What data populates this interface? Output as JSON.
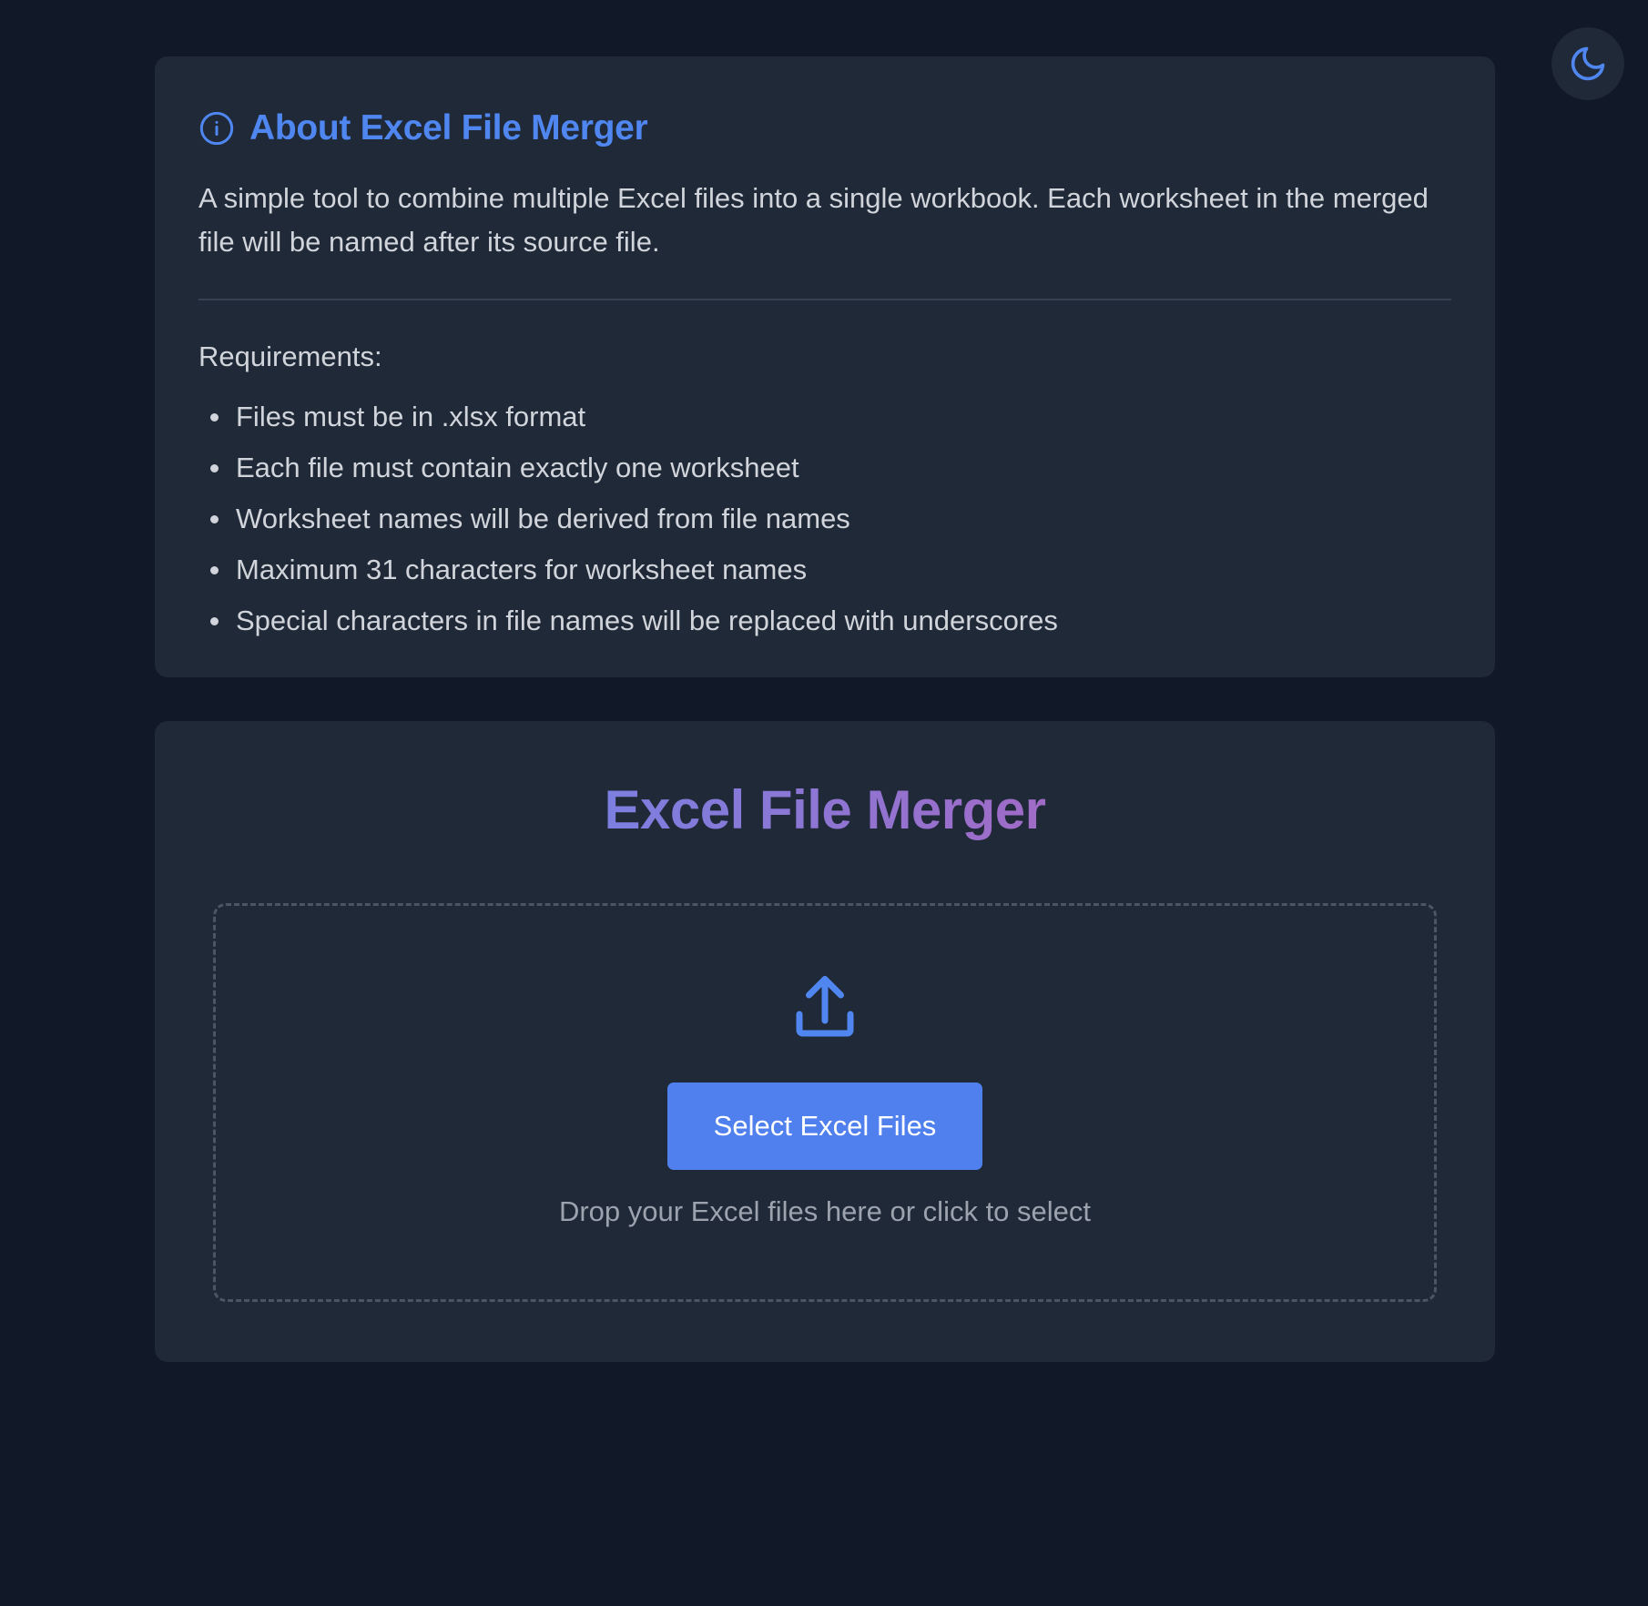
{
  "theme_toggle": {
    "icon": "moon-icon",
    "label": "Toggle dark mode"
  },
  "about": {
    "icon": "info-icon",
    "title": "About Excel File Merger",
    "description": "A simple tool to combine multiple Excel files into a single workbook. Each worksheet in the merged file will be named after its source file.",
    "requirements_title": "Requirements:",
    "requirements": [
      "Files must be in .xlsx format",
      "Each file must contain exactly one worksheet",
      "Worksheet names will be derived from file names",
      "Maximum 31 characters for worksheet names",
      "Special characters in file names will be replaced with underscores"
    ]
  },
  "merger": {
    "title": "Excel File Merger",
    "upload_icon": "upload-icon",
    "select_button_label": "Select Excel Files",
    "drop_hint": "Drop your Excel files here or click to select"
  },
  "colors": {
    "background": "#111827",
    "card": "#1f2937",
    "accent": "#4f80ee",
    "title_gradient_start": "#7c7fe0",
    "title_gradient_end": "#a06bc6"
  }
}
